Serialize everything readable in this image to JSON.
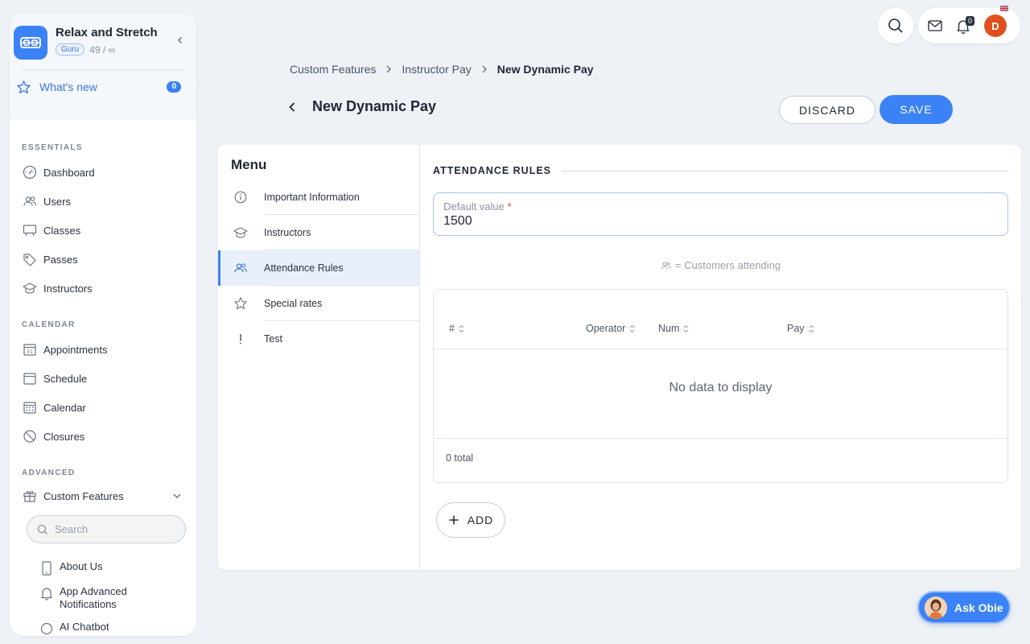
{
  "sidebar": {
    "brand": {
      "name": "Relax and Stretch",
      "badge": "Guru",
      "count": "49 / ∞"
    },
    "whats_new": {
      "label": "What's new",
      "count": "0"
    },
    "sections": {
      "essentials": "ESSENTIALS",
      "calendar": "CALENDAR",
      "advanced": "ADVANCED"
    },
    "essentials_items": [
      {
        "label": "Dashboard",
        "icon": "dashboard-icon"
      },
      {
        "label": "Users",
        "icon": "users-icon"
      },
      {
        "label": "Classes",
        "icon": "classes-icon"
      },
      {
        "label": "Passes",
        "icon": "tag-icon"
      },
      {
        "label": "Instructors",
        "icon": "graduation-cap-icon"
      }
    ],
    "calendar_items": [
      {
        "label": "Appointments",
        "icon": "calendar-31-icon"
      },
      {
        "label": "Schedule",
        "icon": "calendar-icon"
      },
      {
        "label": "Calendar",
        "icon": "calendar-grid-icon"
      },
      {
        "label": "Closures",
        "icon": "ban-icon"
      }
    ],
    "advanced_item": {
      "label": "Custom Features",
      "icon": "gift-icon"
    },
    "search": {
      "placeholder": "Search"
    },
    "sub_items": [
      {
        "label": "About Us",
        "icon": "phone-icon"
      },
      {
        "label": "App Advanced Notifications",
        "icon": "bell-icon"
      },
      {
        "label": "AI Chatbot",
        "icon": "chat-icon"
      }
    ]
  },
  "topbar": {
    "notification_count": "0",
    "avatar_initial": "D"
  },
  "breadcrumb": [
    "Custom Features",
    "Instructor Pay",
    "New Dynamic Pay"
  ],
  "page": {
    "title": "New Dynamic Pay",
    "discard_label": "DISCARD",
    "save_label": "SAVE"
  },
  "menu": {
    "title": "Menu",
    "items": [
      {
        "label": "Important Information",
        "icon": "info-icon"
      },
      {
        "label": "Instructors",
        "icon": "graduation-cap-icon"
      },
      {
        "label": "Attendance Rules",
        "icon": "users-icon",
        "active": true
      },
      {
        "label": "Special rates",
        "icon": "star-icon"
      },
      {
        "label": "Test",
        "icon": "exclamation-icon"
      }
    ]
  },
  "attendance": {
    "section_title": "ATTENDANCE RULES",
    "default_value": {
      "label": "Default value",
      "required_mark": "*",
      "value": "1500"
    },
    "legend": "= Customers attending",
    "table": {
      "columns": [
        "#",
        "Operator",
        "Num",
        "Pay"
      ],
      "rows": [],
      "empty_text": "No data to display",
      "total_text": "0 total"
    },
    "add_label": "ADD"
  },
  "assistant": {
    "label": "Ask Obie"
  },
  "colors": {
    "accent": "#3b82f6",
    "avatar": "#e0501f",
    "background": "#eef1f6"
  }
}
